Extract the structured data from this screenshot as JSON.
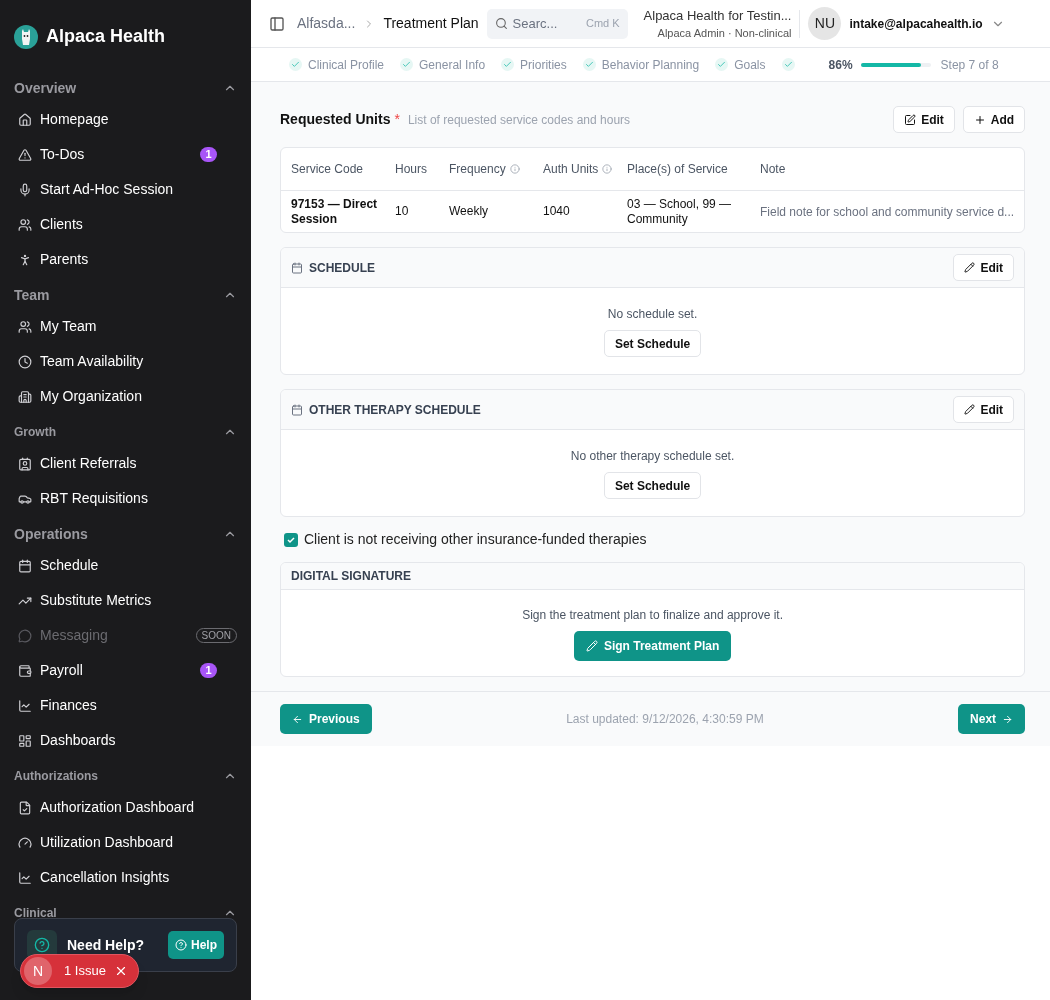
{
  "sidebar": {
    "brand": "Alpaca Health",
    "sections": [
      {
        "title": "Overview",
        "expanded": true,
        "items": [
          {
            "label": "Homepage",
            "disabled": false
          },
          {
            "label": "To-Dos",
            "badge": "1",
            "disabled": false
          },
          {
            "label": "Start Ad-Hoc Session",
            "disabled": false
          },
          {
            "label": "Clients",
            "disabled": false
          },
          {
            "label": "Parents",
            "disabled": false
          }
        ]
      },
      {
        "title": "Team",
        "expanded": true,
        "items": [
          {
            "label": "My Team",
            "disabled": false
          },
          {
            "label": "Team Availability",
            "disabled": false
          },
          {
            "label": "My Organization",
            "disabled": false
          }
        ]
      },
      {
        "title": "Growth",
        "expanded": true,
        "items": [
          {
            "label": "Client Referrals",
            "disabled": false
          },
          {
            "label": "RBT Requisitions",
            "disabled": false
          }
        ]
      },
      {
        "title": "Operations",
        "expanded": true,
        "items": [
          {
            "label": "Schedule",
            "disabled": false
          },
          {
            "label": "Substitute Metrics",
            "disabled": false
          },
          {
            "label": "Messaging",
            "disabled": true,
            "tag": "SOON"
          },
          {
            "label": "Payroll",
            "badge": "1",
            "disabled": false
          },
          {
            "label": "Finances",
            "disabled": false
          },
          {
            "label": "Dashboards",
            "disabled": false
          }
        ]
      },
      {
        "title": "Authorizations",
        "expanded": true,
        "items": [
          {
            "label": "Authorization Dashboard",
            "disabled": false
          },
          {
            "label": "Utilization Dashboard",
            "disabled": false
          },
          {
            "label": "Cancellation Insights",
            "disabled": false
          }
        ]
      },
      {
        "title": "Clinical",
        "expanded": true
      }
    ],
    "help": {
      "title": "Need Help?",
      "button": "Help"
    },
    "issue_toast": {
      "avatar": "N",
      "text": "1 Issue"
    }
  },
  "header": {
    "breadcrumbs": [
      "Alfasda...",
      "Treatment Plan"
    ],
    "search": {
      "placeholder": "Searc...",
      "shortcut": "Cmd K"
    },
    "org": {
      "name": "Alpaca Health for Testin...",
      "role": "Alpaca Admin · Non-clinical"
    },
    "user": {
      "initials": "NU",
      "email": "intake@alpacahealth.io"
    }
  },
  "stepper": {
    "steps": [
      {
        "label": "Clinical Profile",
        "done": true
      },
      {
        "label": "General Info",
        "done": true
      },
      {
        "label": "Priorities",
        "done": true
      },
      {
        "label": "Behavior Planning",
        "done": true
      },
      {
        "label": "Goals",
        "done": true
      },
      {
        "done": true
      }
    ],
    "percent": "86%",
    "level": 0.86,
    "step_text": "Step 7 of 8"
  },
  "requested_units": {
    "title": "Requested Units",
    "required_mark": "*",
    "description": "List of requested service codes and hours",
    "buttons": [
      "Edit",
      "Add"
    ],
    "columns": [
      {
        "label": "Service Code",
        "info": false
      },
      {
        "label": "Hours",
        "info": false
      },
      {
        "label": "Frequency",
        "info": true
      },
      {
        "label": "Auth Units",
        "info": true
      },
      {
        "label": "Place(s) of Service",
        "info": false
      },
      {
        "label": "Note",
        "info": false
      }
    ],
    "rows": [
      [
        "97153 — Direct Session",
        "10",
        "Weekly",
        "1040",
        "03 — School, 99 — Community",
        "Field note for school and community service d..."
      ]
    ]
  },
  "schedules": [
    {
      "title": "SCHEDULE",
      "edit": "Edit",
      "empty": "No schedule set.",
      "button": "Set Schedule"
    },
    {
      "title": "OTHER THERAPY SCHEDULE",
      "edit": "Edit",
      "empty": "No other therapy schedule set.",
      "button": "Set Schedule"
    }
  ],
  "no_other_therapies": {
    "label": "Client is not receiving other insurance-funded therapies",
    "checked": true
  },
  "signature": {
    "title": "DIGITAL SIGNATURE",
    "text": "Sign the treatment plan to finalize and approve it.",
    "button": "Sign Treatment Plan"
  },
  "footer": {
    "previous": "Previous",
    "updated": "Last updated: 9/12/2026, 4:30:59 PM",
    "next": "Next"
  }
}
